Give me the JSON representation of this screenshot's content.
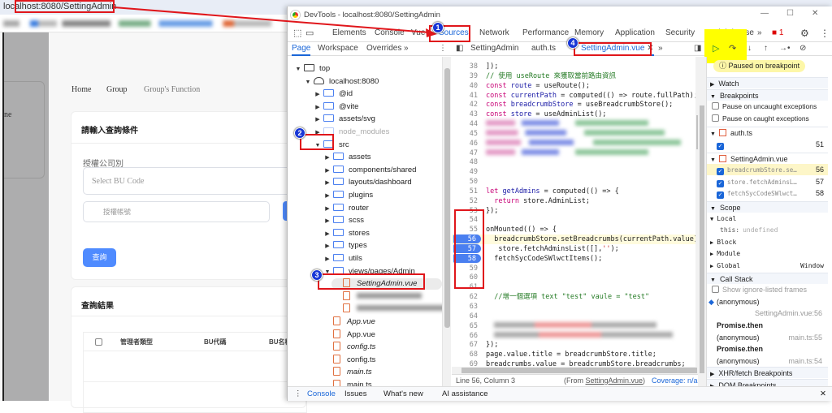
{
  "browser": {
    "url": "localhost:8080/SettingAdmin"
  },
  "page": {
    "breadcrumb": [
      "Home",
      "Group",
      "Group's Function"
    ],
    "sidebar_partial": "ne",
    "query_card": {
      "title": "請輸入查詢條件",
      "company_label": "授權公司別",
      "bu_select_placeholder": "Select BU Code",
      "account_placeholder": "授權帳號",
      "search_button": "查詢"
    },
    "results_card": {
      "title": "查詢結果",
      "columns": [
        "管理者類型",
        "BU代碼",
        "BU名稱"
      ]
    }
  },
  "devtools": {
    "title": "DevTools - localhost:8080/SettingAdmin",
    "tabs": [
      "Elements",
      "Console",
      "Vue",
      "Sources",
      "Network",
      "Performance",
      "Memory",
      "Application",
      "Security",
      "Lighthouse"
    ],
    "more": "»",
    "error_count": "1",
    "nav_tabs": [
      "Page",
      "Workspace",
      "Overrides"
    ],
    "editor_tabs": [
      "SettingAdmin",
      "auth.ts",
      "SettingAdmin.vue"
    ],
    "tree": [
      {
        "label": "top",
        "depth": 0,
        "kind": "frame",
        "open": true
      },
      {
        "label": "localhost:8080",
        "depth": 1,
        "kind": "cloud",
        "open": true
      },
      {
        "label": "@id",
        "depth": 2,
        "kind": "folder"
      },
      {
        "label": "@vite",
        "depth": 2,
        "kind": "folder"
      },
      {
        "label": "assets/svg",
        "depth": 2,
        "kind": "folder"
      },
      {
        "label": "node_modules",
        "depth": 2,
        "kind": "folder",
        "dim": true
      },
      {
        "label": "src",
        "depth": 2,
        "kind": "folder",
        "open": true
      },
      {
        "label": "assets",
        "depth": 3,
        "kind": "folder"
      },
      {
        "label": "components/shared",
        "depth": 3,
        "kind": "folder"
      },
      {
        "label": "layouts/dashboard",
        "depth": 3,
        "kind": "folder"
      },
      {
        "label": "plugins",
        "depth": 3,
        "kind": "folder"
      },
      {
        "label": "router",
        "depth": 3,
        "kind": "folder"
      },
      {
        "label": "scss",
        "depth": 3,
        "kind": "folder"
      },
      {
        "label": "stores",
        "depth": 3,
        "kind": "folder"
      },
      {
        "label": "types",
        "depth": 3,
        "kind": "folder"
      },
      {
        "label": "utils",
        "depth": 3,
        "kind": "folder"
      },
      {
        "label": "views/pages/Admin",
        "depth": 3,
        "kind": "folder",
        "open": true
      },
      {
        "label": "SettingAdmin.vue",
        "depth": 4,
        "kind": "file",
        "italic": true,
        "selected": true
      },
      {
        "label": "",
        "depth": 4,
        "kind": "file",
        "blurred": true
      },
      {
        "label": "",
        "depth": 4,
        "kind": "file",
        "blurred": true
      },
      {
        "label": "App.vue",
        "depth": 3,
        "kind": "file",
        "italic": true
      },
      {
        "label": "App.vue",
        "depth": 3,
        "kind": "file"
      },
      {
        "label": "config.ts",
        "depth": 3,
        "kind": "file",
        "italic": true
      },
      {
        "label": "config.ts",
        "depth": 3,
        "kind": "file"
      },
      {
        "label": "main.ts",
        "depth": 3,
        "kind": "file",
        "italic": true
      },
      {
        "label": "main.ts",
        "depth": 3,
        "kind": "file"
      }
    ],
    "code": [
      {
        "n": "38",
        "t": [
          [
            "p",
            "]);"
          ]
        ]
      },
      {
        "n": "39",
        "t": [
          [
            "c",
            "// 使用 useRoute 來獲取當前路由資訊"
          ]
        ]
      },
      {
        "n": "40",
        "t": [
          [
            "k",
            "const "
          ],
          [
            "v",
            "route"
          ],
          [
            "p",
            " = useRoute();"
          ]
        ]
      },
      {
        "n": "41",
        "t": [
          [
            "k",
            "const "
          ],
          [
            "v",
            "currentPath"
          ],
          [
            "p",
            " = computed(() => route.fullPath);"
          ]
        ]
      },
      {
        "n": "42",
        "t": [
          [
            "k",
            "const "
          ],
          [
            "v",
            "breadcrumbStore"
          ],
          [
            "p",
            " = useBreadcrumbStore();"
          ]
        ]
      },
      {
        "n": "43",
        "t": [
          [
            "k",
            "const "
          ],
          [
            "v",
            "store"
          ],
          [
            "p",
            " = useAdminList();"
          ]
        ]
      },
      {
        "n": "44",
        "blur": true
      },
      {
        "n": "45",
        "blur": true
      },
      {
        "n": "46",
        "blur": true
      },
      {
        "n": "47",
        "blur": true
      },
      {
        "n": "48",
        "t": []
      },
      {
        "n": "49",
        "t": []
      },
      {
        "n": "50",
        "t": []
      },
      {
        "n": "51",
        "t": [
          [
            "k",
            "let "
          ],
          [
            "v",
            "getAdmins"
          ],
          [
            "p",
            " = computed(() => {"
          ]
        ]
      },
      {
        "n": "52",
        "t": [
          [
            "k",
            "  return "
          ],
          [
            "p",
            "store.AdminList;"
          ]
        ]
      },
      {
        "n": "53",
        "t": [
          [
            "p",
            "});"
          ]
        ]
      },
      {
        "n": "54",
        "t": []
      },
      {
        "n": "55",
        "t": [
          [
            "p",
            "onMounted(() => {"
          ]
        ]
      },
      {
        "n": "56",
        "bp": true,
        "paused": true,
        "t": [
          [
            "p",
            "  breadcrumbStore.setBreadcrumbs(currentPath.value);"
          ]
        ]
      },
      {
        "n": "57",
        "bp": true,
        "t": [
          [
            "p",
            "   store.fetchAdminsList([],"
          ],
          [
            "s",
            "''"
          ],
          [
            "p",
            ");"
          ]
        ]
      },
      {
        "n": "58",
        "bp": true,
        "t": [
          [
            "p",
            "  fetchSycCodeSWlwctItems();"
          ]
        ]
      },
      {
        "n": "59",
        "t": []
      },
      {
        "n": "60",
        "t": []
      },
      {
        "n": "61",
        "t": []
      },
      {
        "n": "62",
        "t": [
          [
            "c",
            "  //增一個選項 text \"test\" vaule = \"test\""
          ]
        ]
      },
      {
        "n": "63",
        "t": []
      },
      {
        "n": "64",
        "t": []
      },
      {
        "n": "65",
        "blur": true,
        "red": true
      },
      {
        "n": "66",
        "blur": true,
        "red": true
      },
      {
        "n": "67",
        "t": [
          [
            "p",
            "});"
          ]
        ]
      },
      {
        "n": "68",
        "t": [
          [
            "p",
            "page.value.title = breadcrumbStore.title;"
          ]
        ]
      },
      {
        "n": "69",
        "t": [
          [
            "p",
            "breadcrumbs.value = breadcrumbStore.breadcrumbs;"
          ]
        ]
      }
    ],
    "status": {
      "position": "Line 56, Column 3",
      "from_prefix": "(From ",
      "from_file": "SettingAdmin.vue",
      "from_suffix": ")",
      "coverage": "Coverage: n/a"
    },
    "drawer_tabs": [
      "Console",
      "Issues",
      "What's new",
      "AI assistance"
    ],
    "debugger": {
      "paused": "Paused on breakpoint",
      "watch": "Watch",
      "breakpoints": "Breakpoints",
      "pause_uncaught": "Pause on uncaught exceptions",
      "pause_caught": "Pause on caught exceptions",
      "bp_files": [
        {
          "file": "auth.ts",
          "items": [
            {
              "code": "",
              "line": "51"
            }
          ]
        },
        {
          "file": "SettingAdmin.vue",
          "items": [
            {
              "code": "breadcrumbStore.se…",
              "line": "56"
            },
            {
              "code": "store.fetchAdminsL…",
              "line": "57"
            },
            {
              "code": "fetchSycCodeSWlwct…",
              "line": "58"
            }
          ]
        }
      ],
      "scope": "Scope",
      "local": "Local",
      "this_key": "this:",
      "this_val": "undefined",
      "block": "Block",
      "module": "Module",
      "global": "Global",
      "global_val": "Window",
      "call_stack": "Call Stack",
      "show_ignore": "Show ignore-listed frames",
      "frames": [
        {
          "name": "(anonymous)",
          "loc": "SettingAdmin.vue:56",
          "current": true
        },
        {
          "async": "Promise.then"
        },
        {
          "name": "(anonymous)",
          "loc": "main.ts:55"
        },
        {
          "async": "Promise.then"
        },
        {
          "name": "(anonymous)",
          "loc": "main.ts:54"
        }
      ],
      "xhr": "XHR/fetch Breakpoints",
      "dom": "DOM Breakpoints"
    }
  },
  "annotations": [
    "1",
    "2",
    "3",
    "4"
  ],
  "colors": {
    "accent": "#1a66d8",
    "annotation": "#e0161b",
    "highlight": "#ffff00",
    "breakpoint": "#4a7ff0",
    "button": "#4f8bff"
  }
}
